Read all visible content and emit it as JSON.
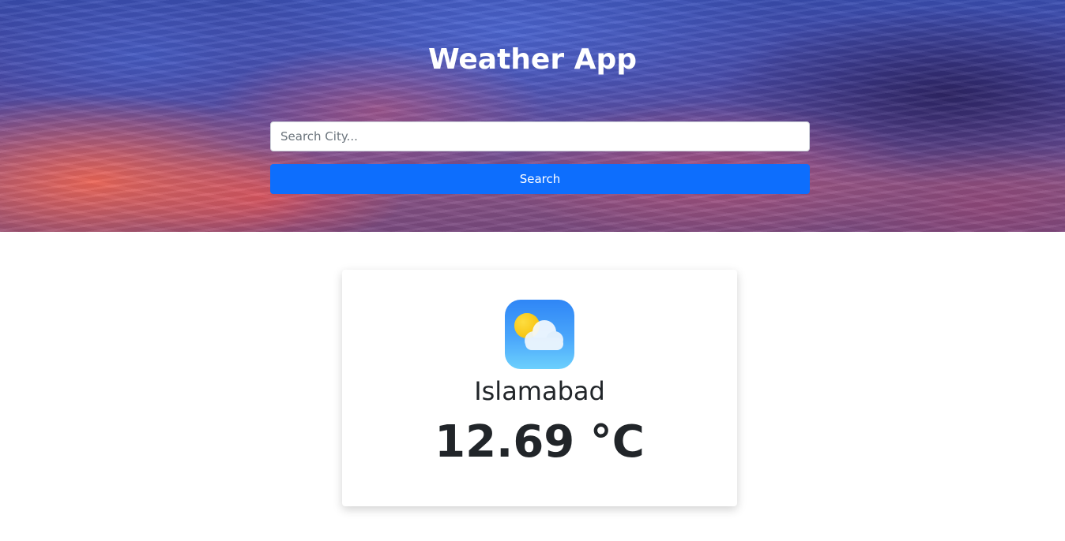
{
  "header": {
    "title": "Weather App"
  },
  "search": {
    "placeholder": "Search City...",
    "value": "",
    "button_label": "Search"
  },
  "weather_card": {
    "icon": "partly-cloudy-icon",
    "city": "Islamabad",
    "temperature": "12.69 °C"
  },
  "colors": {
    "button_primary": "#0d6efd",
    "text_dark": "#212529",
    "icon_bg_top": "#2f86f6",
    "icon_bg_bottom": "#6cd0fd",
    "sun": "#fcd116"
  }
}
